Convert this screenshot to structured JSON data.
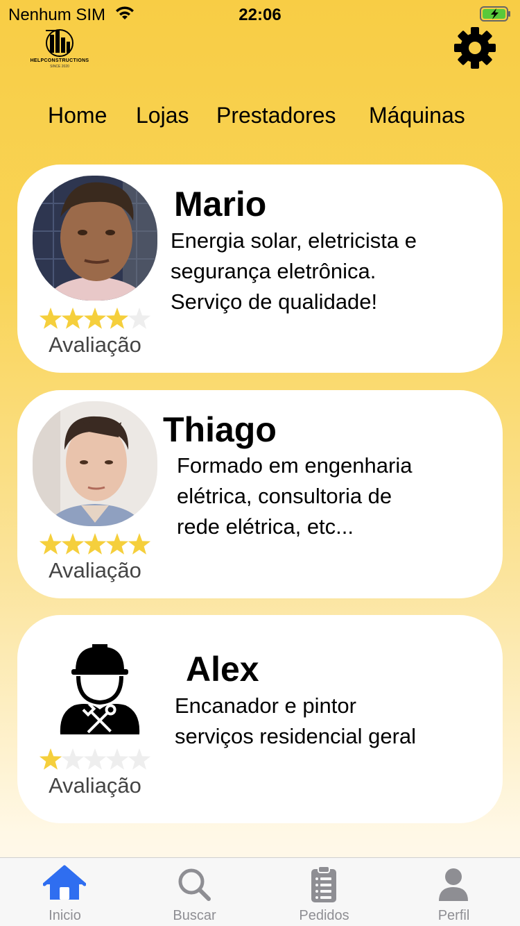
{
  "status_bar": {
    "carrier": "Nenhum SIM",
    "time": "22:06"
  },
  "brand": {
    "name": "HELPCONSTRUCTIONS",
    "tagline": "SINCE 2020"
  },
  "nav": {
    "items": [
      "Home",
      "Lojas",
      "Prestadores",
      "Máquinas"
    ]
  },
  "providers": [
    {
      "name": "Mario",
      "description": [
        "Energia solar, eletricista e",
        "segurança eletrônica.",
        "Serviço de qualidade!"
      ],
      "rating": 4,
      "rating_max": 5,
      "rating_label": "Avaliação"
    },
    {
      "name": "Thiago",
      "description": [
        "Formado em engenharia",
        "elétrica, consultoria de",
        "rede elétrica, etc..."
      ],
      "rating": 5,
      "rating_max": 5,
      "rating_label": "Avaliação"
    },
    {
      "name": "Alex",
      "description": [
        "Encanador e pintor",
        "serviços residencial geral"
      ],
      "rating": 1,
      "rating_max": 5,
      "rating_label": "Avaliação"
    }
  ],
  "tab_bar": {
    "tabs": [
      {
        "label": "Inicio",
        "icon": "home-icon",
        "active": true
      },
      {
        "label": "Buscar",
        "icon": "search-icon",
        "active": false
      },
      {
        "label": "Pedidos",
        "icon": "clipboard-icon",
        "active": false
      },
      {
        "label": "Perfil",
        "icon": "person-icon",
        "active": false
      }
    ]
  },
  "colors": {
    "background_top": "#f8cd45",
    "star_filled": "#f5cf3c",
    "star_empty": "#eeeeee",
    "tab_active": "#2f6ef0",
    "tab_inactive": "#8e8e93"
  }
}
